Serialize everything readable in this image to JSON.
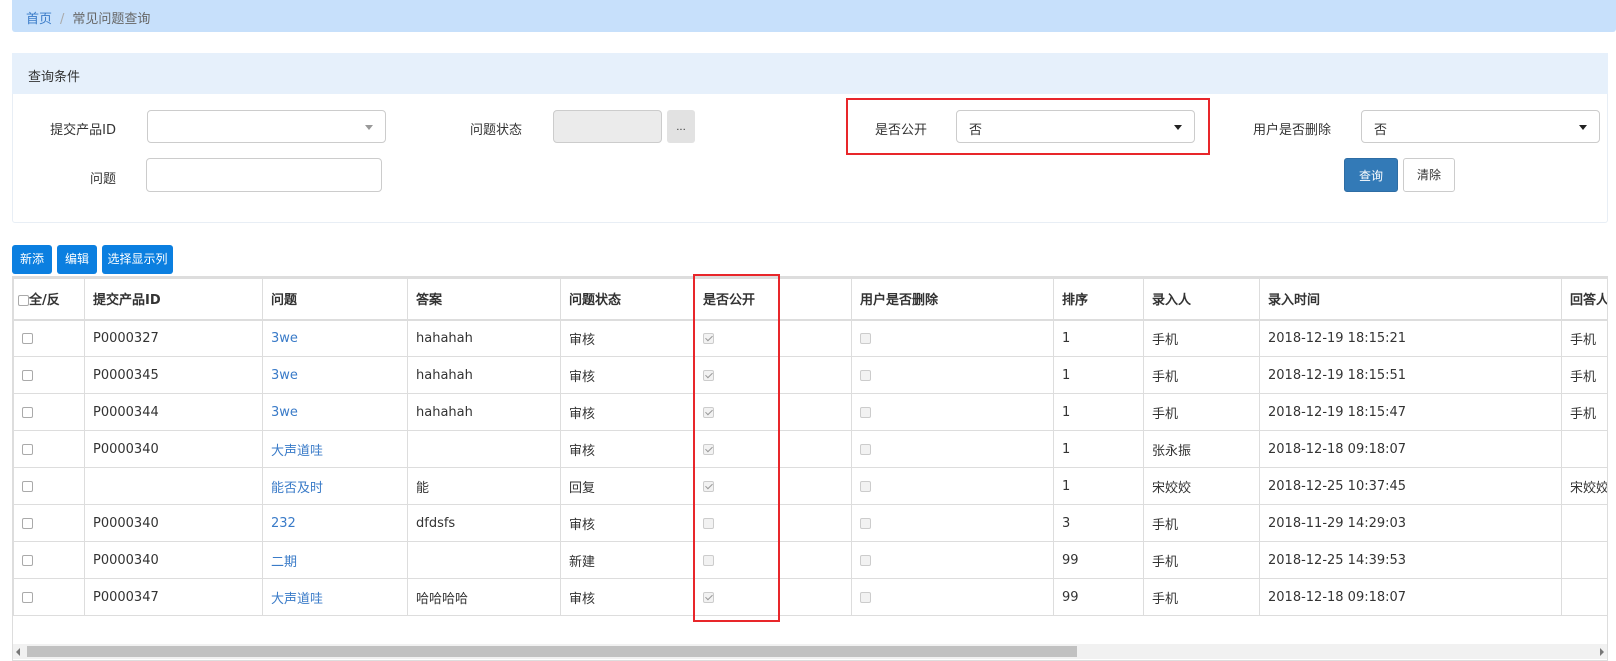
{
  "breadcrumb": {
    "home": "首页",
    "separator": "/",
    "current": "常见问题查询"
  },
  "search_panel": {
    "title": "查询条件",
    "product_id_label": "提交产品ID",
    "product_id_value": "",
    "status_label": "问题状态",
    "status_value": "",
    "status_button": "...",
    "public_label": "是否公开",
    "public_value": "否",
    "deleted_label": "用户是否删除",
    "deleted_value": "否",
    "question_label": "问题",
    "question_value": "",
    "search_button": "查询",
    "clear_button": "清除"
  },
  "toolbar": {
    "add": "新添",
    "edit": "编辑",
    "columns": "选择显示列"
  },
  "table": {
    "headers": [
      "全/反",
      "提交产品ID",
      "问题",
      "答案",
      "问题状态",
      "是否公开",
      "用户是否删除",
      "排序",
      "录入人",
      "录入时间",
      "回答人"
    ],
    "rows": [
      {
        "product_id": "P0000327",
        "question": "3we",
        "answer": "hahahah",
        "status": "审核",
        "public": true,
        "deleted": false,
        "order": "1",
        "creator": "手机",
        "time": "2018-12-19 18:15:21",
        "answerer": "手机"
      },
      {
        "product_id": "P0000345",
        "question": "3we",
        "answer": "hahahah",
        "status": "审核",
        "public": true,
        "deleted": false,
        "order": "1",
        "creator": "手机",
        "time": "2018-12-19 18:15:51",
        "answerer": "手机"
      },
      {
        "product_id": "P0000344",
        "question": "3we",
        "answer": "hahahah",
        "status": "审核",
        "public": true,
        "deleted": false,
        "order": "1",
        "creator": "手机",
        "time": "2018-12-19 18:15:47",
        "answerer": "手机"
      },
      {
        "product_id": "P0000340",
        "question": "大声道哇",
        "answer": "",
        "status": "审核",
        "public": true,
        "deleted": false,
        "order": "1",
        "creator": "张永振",
        "time": "2018-12-18 09:18:07",
        "answerer": ""
      },
      {
        "product_id": "",
        "question": "能否及时",
        "answer": "能",
        "status": "回复",
        "public": true,
        "deleted": false,
        "order": "1",
        "creator": "宋姣姣",
        "time": "2018-12-25 10:37:45",
        "answerer": "宋姣姣"
      },
      {
        "product_id": "P0000340",
        "question": "232",
        "answer": "dfdsfs",
        "status": "审核",
        "public": false,
        "deleted": false,
        "order": "3",
        "creator": "手机",
        "time": "2018-11-29 14:29:03",
        "answerer": ""
      },
      {
        "product_id": "P0000340",
        "question": "二期",
        "answer": "",
        "status": "新建",
        "public": false,
        "deleted": false,
        "order": "99",
        "creator": "手机",
        "time": "2018-12-25 14:39:53",
        "answerer": ""
      },
      {
        "product_id": "P0000347",
        "question": "大声道哇",
        "answer": "哈哈哈哈",
        "status": "审核",
        "public": true,
        "deleted": false,
        "order": "99",
        "creator": "手机",
        "time": "2018-12-18 09:18:07",
        "answerer": ""
      }
    ]
  },
  "colors": {
    "primary": "#0b7fe0",
    "highlight": "#e8262a",
    "link": "#3a7bc8"
  }
}
